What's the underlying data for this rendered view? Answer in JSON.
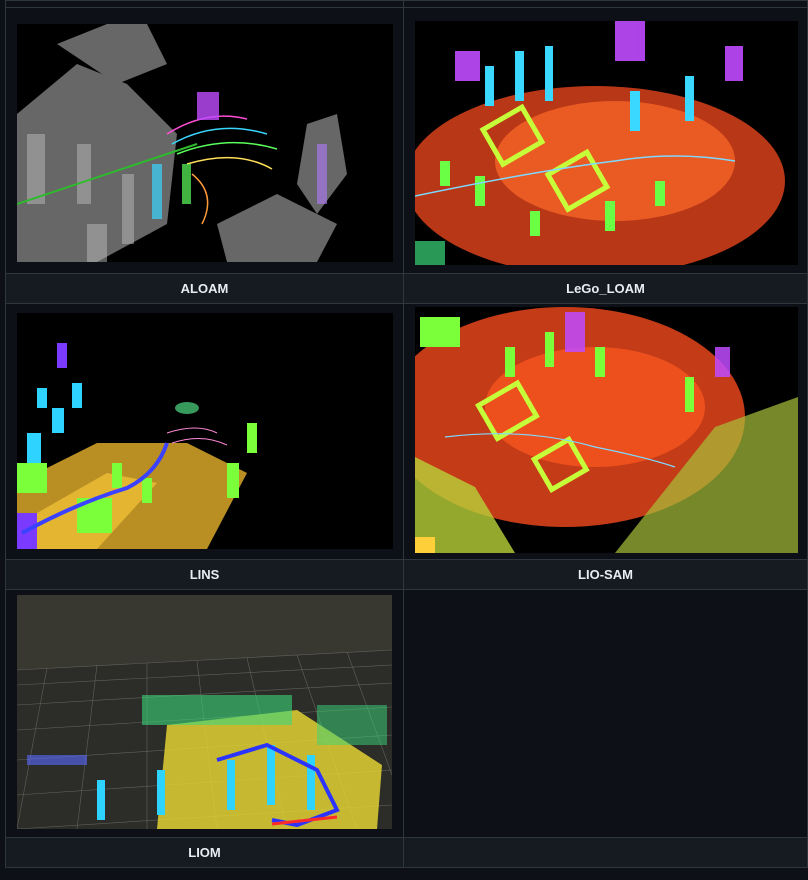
{
  "table": {
    "rows": [
      {
        "left": {
          "label": "ALOAM",
          "image": "aloam-pointcloud-map"
        },
        "right": {
          "label": "LeGo_LOAM",
          "image": "lego-loam-pointcloud-map"
        }
      },
      {
        "left": {
          "label": "LINS",
          "image": "lins-pointcloud-map"
        },
        "right": {
          "label": "LIO-SAM",
          "image": "lio-sam-pointcloud-map"
        }
      },
      {
        "left": {
          "label": "LIOM",
          "image": "liom-pointcloud-map"
        },
        "right": {
          "label": "",
          "image": ""
        }
      }
    ]
  },
  "colors": {
    "page_bg": "#0d1117",
    "label_bg": "#161b22",
    "border": "#30363d",
    "text": "#e6edf3"
  }
}
